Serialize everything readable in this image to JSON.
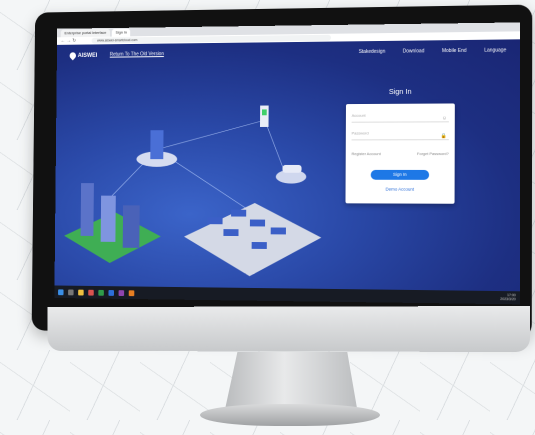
{
  "browser": {
    "tabs": [
      "Enterprise portal Interface",
      "Sign In"
    ],
    "url": "www.aiswei-smartcloud.com"
  },
  "header": {
    "logo_text": "AISWEI",
    "old_version_link": "Return To The Old Version",
    "menu": [
      "Stakedesign",
      "Download",
      "Mobile End",
      "Language"
    ]
  },
  "signin": {
    "title": "Sign In",
    "account_placeholder": "Account",
    "password_placeholder": "Password",
    "register_link": "Register Account",
    "forgot_link": "Forget Password?",
    "button_label": "Sign In",
    "demo_link": "Demo Account"
  },
  "taskbar": {
    "time": "17:00",
    "date": "2023/3/20"
  },
  "colors": {
    "page_bg": "#1d2f82",
    "accent": "#1e78e6"
  }
}
